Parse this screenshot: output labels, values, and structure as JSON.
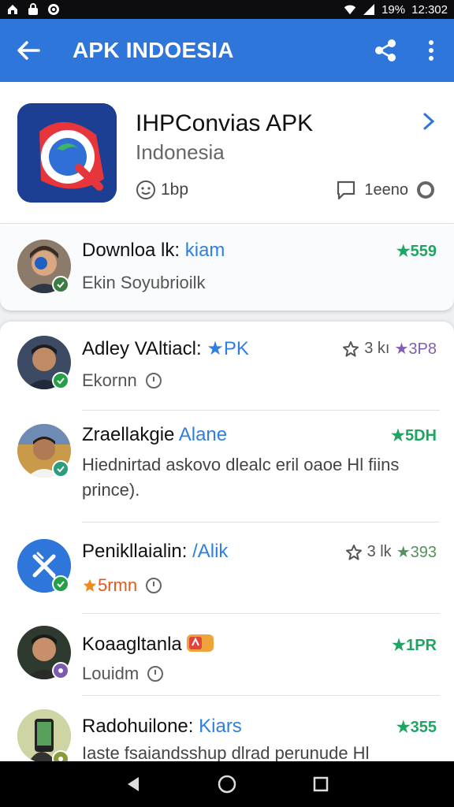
{
  "status_bar": {
    "battery": "19%",
    "time": "12:302"
  },
  "app_bar": {
    "title": "APK INDOESIA"
  },
  "app": {
    "name": "IHPConvias APK",
    "subtitle": "Indonesia",
    "meta_left": "1bp",
    "meta_right": "1eeno"
  },
  "download": {
    "title": "Downloa lk:",
    "title_highlight": "kiam",
    "subtitle": "Ekin Soyubrioilk",
    "count": "★559"
  },
  "items": [
    {
      "title": "Adley VAltiacl:",
      "highlight": "★PK",
      "sub": "Ekornn",
      "rating": "3 kı",
      "count": "★3P8"
    },
    {
      "title": "Zraellakgie",
      "highlight": "Alane",
      "desc": "Hiednirtad askovo dlealc eril oaoe Hl fiins prince).",
      "count": "★5DH"
    },
    {
      "title": "Penikllaialin:",
      "highlight": "/Alik",
      "sub": "5rmn",
      "rating": "3 lk",
      "count": "★393"
    },
    {
      "title": "Koaagltanla",
      "sub": "Louidm",
      "count": "★1PR"
    },
    {
      "title": "Radohuilone:",
      "highlight": "Kiars",
      "desc": "Iaste fsaiandsshup dlrad perunude Hl",
      "count": "★355"
    }
  ]
}
